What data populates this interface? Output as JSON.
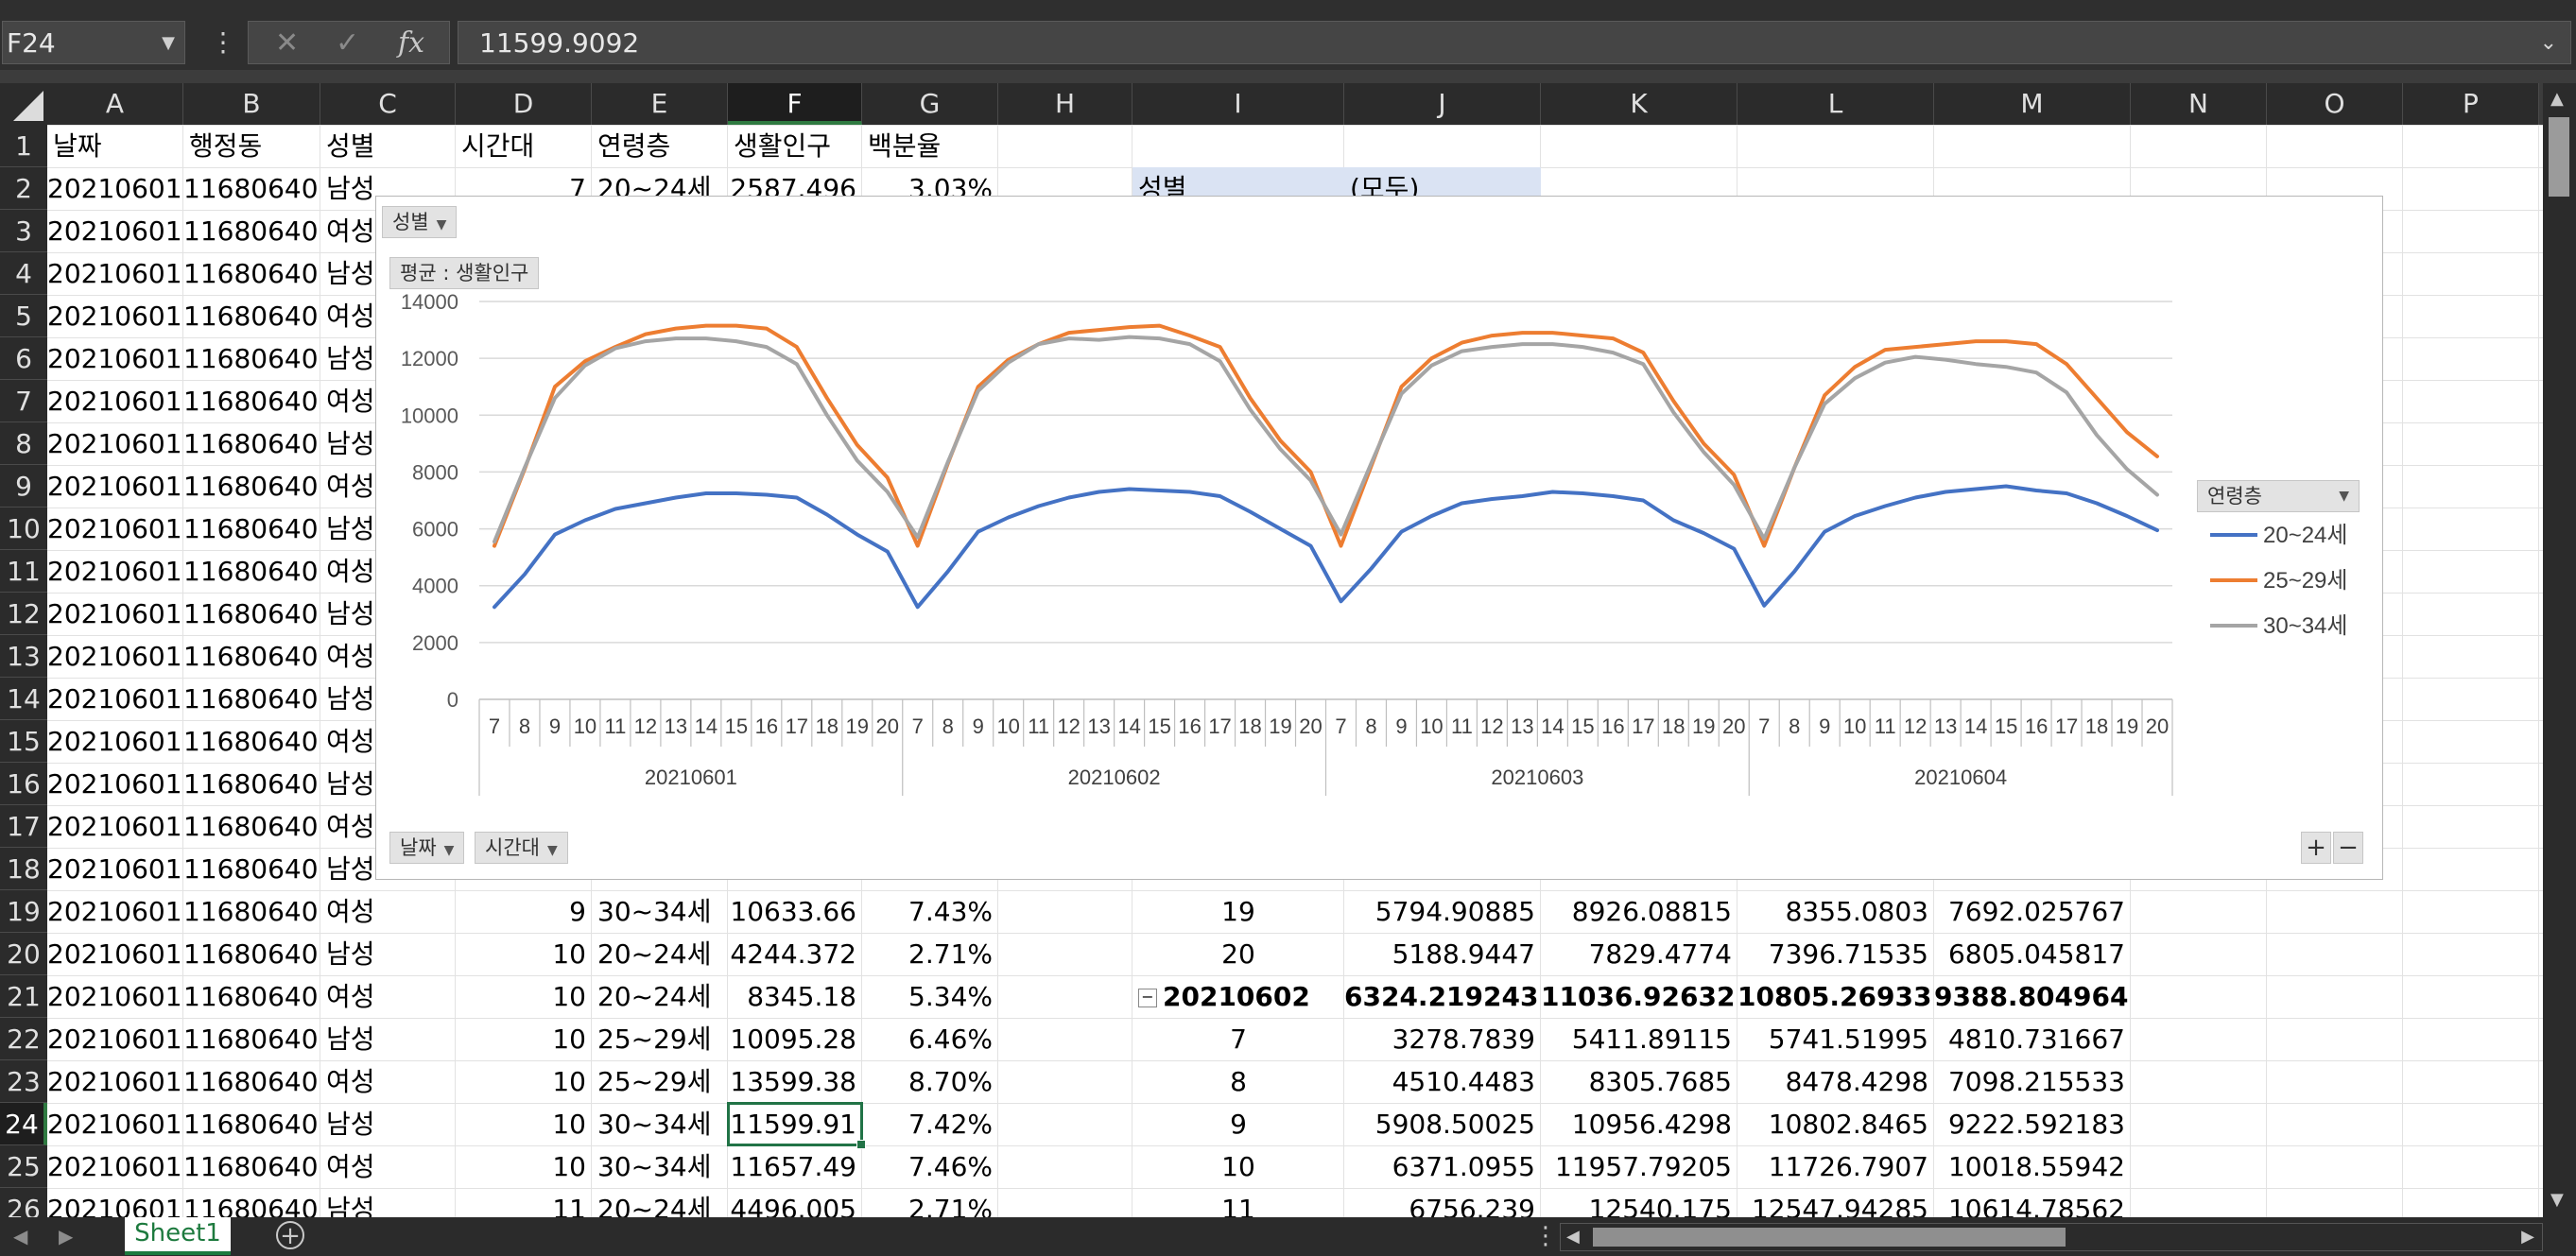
{
  "name_box": "F24",
  "formula_bar": {
    "cancel_glyph": "✕",
    "enter_glyph": "✓",
    "function_glyph": "fx",
    "value": "11599.9092"
  },
  "columns": [
    "A",
    "B",
    "C",
    "D",
    "E",
    "F",
    "G",
    "H",
    "I",
    "J",
    "K",
    "L",
    "M",
    "N",
    "O",
    "P"
  ],
  "selected_column": "F",
  "selected_row": "24",
  "rows": [
    "1",
    "2",
    "3",
    "4",
    "5",
    "6",
    "7",
    "8",
    "9",
    "10",
    "11",
    "12",
    "13",
    "14",
    "15",
    "16",
    "17",
    "18",
    "19",
    "20",
    "21",
    "22",
    "23",
    "24",
    "25",
    "26"
  ],
  "headers": {
    "date": "날짜",
    "dong": "행정동",
    "sex": "성별",
    "time": "시간대",
    "age": "연령층",
    "pop": "생활인구",
    "pct": "백분율"
  },
  "left_rows": [
    {
      "date": "20210601",
      "dong": "11680640",
      "sex": "남성",
      "time": "7",
      "age": "20~24세",
      "pop": "2587.496",
      "pct": "3.03%"
    },
    {
      "date": "20210601",
      "dong": "11680640",
      "sex": "여성",
      "time": "",
      "age": "",
      "pop": "",
      "pct": ""
    },
    {
      "date": "20210601",
      "dong": "11680640",
      "sex": "남성",
      "time": "",
      "age": "",
      "pop": "",
      "pct": ""
    },
    {
      "date": "20210601",
      "dong": "11680640",
      "sex": "여성",
      "time": "",
      "age": "",
      "pop": "",
      "pct": ""
    },
    {
      "date": "20210601",
      "dong": "11680640",
      "sex": "남성",
      "time": "",
      "age": "",
      "pop": "",
      "pct": ""
    },
    {
      "date": "20210601",
      "dong": "11680640",
      "sex": "여성",
      "time": "",
      "age": "",
      "pop": "",
      "pct": ""
    },
    {
      "date": "20210601",
      "dong": "11680640",
      "sex": "남성",
      "time": "",
      "age": "",
      "pop": "",
      "pct": ""
    },
    {
      "date": "20210601",
      "dong": "11680640",
      "sex": "여성",
      "time": "",
      "age": "",
      "pop": "",
      "pct": ""
    },
    {
      "date": "20210601",
      "dong": "11680640",
      "sex": "남성",
      "time": "",
      "age": "",
      "pop": "",
      "pct": ""
    },
    {
      "date": "20210601",
      "dong": "11680640",
      "sex": "여성",
      "time": "",
      "age": "",
      "pop": "",
      "pct": ""
    },
    {
      "date": "20210601",
      "dong": "11680640",
      "sex": "남성",
      "time": "",
      "age": "",
      "pop": "",
      "pct": ""
    },
    {
      "date": "20210601",
      "dong": "11680640",
      "sex": "여성",
      "time": "",
      "age": "",
      "pop": "",
      "pct": ""
    },
    {
      "date": "20210601",
      "dong": "11680640",
      "sex": "남성",
      "time": "",
      "age": "",
      "pop": "",
      "pct": ""
    },
    {
      "date": "20210601",
      "dong": "11680640",
      "sex": "여성",
      "time": "",
      "age": "",
      "pop": "",
      "pct": ""
    },
    {
      "date": "20210601",
      "dong": "11680640",
      "sex": "남성",
      "time": "",
      "age": "",
      "pop": "",
      "pct": ""
    },
    {
      "date": "20210601",
      "dong": "11680640",
      "sex": "여성",
      "time": "",
      "age": "",
      "pop": "",
      "pct": ""
    },
    {
      "date": "20210601",
      "dong": "11680640",
      "sex": "남성",
      "time": "",
      "age": "",
      "pop": "",
      "pct": ""
    },
    {
      "date": "20210601",
      "dong": "11680640",
      "sex": "여성",
      "time": "9",
      "age": "30~34세",
      "pop": "10633.66",
      "pct": "7.43%"
    },
    {
      "date": "20210601",
      "dong": "11680640",
      "sex": "남성",
      "time": "10",
      "age": "20~24세",
      "pop": "4244.372",
      "pct": "2.71%"
    },
    {
      "date": "20210601",
      "dong": "11680640",
      "sex": "여성",
      "time": "10",
      "age": "20~24세",
      "pop": "8345.18",
      "pct": "5.34%"
    },
    {
      "date": "20210601",
      "dong": "11680640",
      "sex": "남성",
      "time": "10",
      "age": "25~29세",
      "pop": "10095.28",
      "pct": "6.46%"
    },
    {
      "date": "20210601",
      "dong": "11680640",
      "sex": "여성",
      "time": "10",
      "age": "25~29세",
      "pop": "13599.38",
      "pct": "8.70%"
    },
    {
      "date": "20210601",
      "dong": "11680640",
      "sex": "남성",
      "time": "10",
      "age": "30~34세",
      "pop": "11599.91",
      "pct": "7.42%"
    },
    {
      "date": "20210601",
      "dong": "11680640",
      "sex": "여성",
      "time": "10",
      "age": "30~34세",
      "pop": "11657.49",
      "pct": "7.46%"
    },
    {
      "date": "20210601",
      "dong": "11680640",
      "sex": "남성",
      "time": "11",
      "age": "20~24세",
      "pop": "4496.005",
      "pct": "2.71%"
    }
  ],
  "pivot": {
    "filter_label": "성별",
    "filter_value": "(모두)",
    "rows": [
      {
        "label": "19",
        "j": "5794.90885",
        "k": "8926.08815",
        "l": "8355.0803",
        "m": "7692.025767",
        "bold": false,
        "collapse": false
      },
      {
        "label": "20",
        "j": "5188.9447",
        "k": "7829.4774",
        "l": "7396.71535",
        "m": "6805.045817",
        "bold": false,
        "collapse": false
      },
      {
        "label": "20210602",
        "j": "6324.219243",
        "k": "11036.92632",
        "l": "10805.26933",
        "m": "9388.804964",
        "bold": true,
        "collapse": true
      },
      {
        "label": "7",
        "j": "3278.7839",
        "k": "5411.89115",
        "l": "5741.51995",
        "m": "4810.731667",
        "bold": false,
        "collapse": false
      },
      {
        "label": "8",
        "j": "4510.4483",
        "k": "8305.7685",
        "l": "8478.4298",
        "m": "7098.215533",
        "bold": false,
        "collapse": false
      },
      {
        "label": "9",
        "j": "5908.50025",
        "k": "10956.4298",
        "l": "10802.8465",
        "m": "9222.592183",
        "bold": false,
        "collapse": false
      },
      {
        "label": "10",
        "j": "6371.0955",
        "k": "11957.79205",
        "l": "11726.7907",
        "m": "10018.55942",
        "bold": false,
        "collapse": false
      },
      {
        "label": "11",
        "j": "6756.239",
        "k": "12540.175",
        "l": "12547.94285",
        "m": "10614.78562",
        "bold": false,
        "collapse": false
      }
    ]
  },
  "chart_buttons": {
    "sex": "성별",
    "value": "평균 : 생활인구",
    "date": "날짜",
    "time": "시간대",
    "legend_field": "연령층",
    "zoom_in": "+",
    "zoom_out": "−"
  },
  "chart_data": {
    "type": "line",
    "ylim": [
      0,
      14000
    ],
    "yticks": [
      "0",
      "2000",
      "4000",
      "6000",
      "8000",
      "10000",
      "12000",
      "14000"
    ],
    "grid": true,
    "legend_position": "right",
    "dates": [
      "20210601",
      "20210602",
      "20210603",
      "20210604"
    ],
    "hours": [
      "7",
      "8",
      "9",
      "10",
      "11",
      "12",
      "13",
      "14",
      "15",
      "16",
      "17",
      "18",
      "19",
      "20"
    ],
    "series": [
      {
        "name": "20~24세",
        "color": "#4472c4",
        "values": [
          3250,
          4400,
          5800,
          6300,
          6700,
          6900,
          7100,
          7250,
          7250,
          7200,
          7100,
          6500,
          5800,
          5200,
          3250,
          4500,
          5900,
          6400,
          6800,
          7100,
          7300,
          7400,
          7350,
          7300,
          7150,
          6600,
          6000,
          5400,
          3450,
          4600,
          5900,
          6450,
          6900,
          7050,
          7150,
          7300,
          7250,
          7150,
          7000,
          6300,
          5850,
          5300,
          3300,
          4500,
          5900,
          6450,
          6800,
          7100,
          7300,
          7400,
          7500,
          7350,
          7250,
          6900,
          6450,
          5950
        ]
      },
      {
        "name": "25~29세",
        "color": "#ed7d31",
        "values": [
          5400,
          8100,
          11000,
          11900,
          12400,
          12850,
          13050,
          13150,
          13150,
          13050,
          12400,
          10600,
          8950,
          7800,
          5400,
          8300,
          11000,
          11950,
          12500,
          12900,
          13000,
          13100,
          13150,
          12800,
          12400,
          10600,
          9100,
          8000,
          5400,
          8200,
          11000,
          12000,
          12550,
          12800,
          12900,
          12900,
          12800,
          12700,
          12200,
          10500,
          9000,
          7900,
          5400,
          8150,
          10700,
          11700,
          12300,
          12400,
          12500,
          12600,
          12600,
          12500,
          11800,
          10600,
          9400,
          8550
        ]
      },
      {
        "name": "30~34세",
        "color": "#a5a5a5",
        "values": [
          5550,
          8150,
          10600,
          11750,
          12350,
          12600,
          12700,
          12700,
          12600,
          12400,
          11800,
          10000,
          8400,
          7300,
          5700,
          8350,
          10850,
          11850,
          12500,
          12700,
          12650,
          12750,
          12700,
          12500,
          11900,
          10200,
          8800,
          7700,
          5800,
          8300,
          10750,
          11750,
          12250,
          12400,
          12500,
          12500,
          12400,
          12200,
          11800,
          10100,
          8700,
          7550,
          5650,
          8150,
          10400,
          11300,
          11850,
          12050,
          11950,
          11800,
          11700,
          11500,
          10800,
          9300,
          8100,
          7200
        ]
      }
    ]
  },
  "sheet_tab": "Sheet1"
}
